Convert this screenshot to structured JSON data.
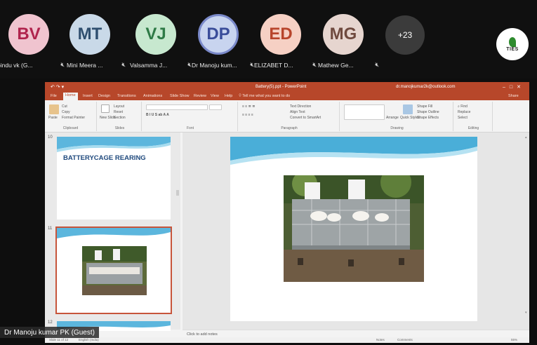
{
  "participants": [
    {
      "initials": "BV",
      "name": "pindu vk (G...",
      "bg": "#f0c4cf",
      "fg": "#b0244d"
    },
    {
      "initials": "MT",
      "name": "Mini Meera ...",
      "bg": "#c9d9e8",
      "fg": "#2f4f6f"
    },
    {
      "initials": "VJ",
      "name": "Valsamma J...",
      "bg": "#c7e8cf",
      "fg": "#2e7a46"
    },
    {
      "initials": "DP",
      "name": "Dr Manoju kum...",
      "bg": "#c8d4ef",
      "fg": "#3a4d9a"
    },
    {
      "initials": "ED",
      "name": "ELIZABET D...",
      "bg": "#f6d0c4",
      "fg": "#b8452c"
    },
    {
      "initials": "MG",
      "name": "Mathew Ge...",
      "bg": "#e6d5cf",
      "fg": "#6f4a3f"
    }
  ],
  "more_count": "+23",
  "logo_text": "TIES",
  "app": {
    "doc_title": "Battery(5).ppt - PowerPoint",
    "account": "dr.manojkumar2k@outlook.com",
    "tabs": [
      "File",
      "Home",
      "Insert",
      "Design",
      "Transitions",
      "Animations",
      "Slide Show",
      "Review",
      "View",
      "Help"
    ],
    "tell_me": "Tell me what you want to do",
    "share": "Share",
    "groups": [
      "Clipboard",
      "Slides",
      "Font",
      "Paragraph",
      "Drawing",
      "Editing"
    ],
    "ribbon": {
      "paste": "Paste",
      "cut": "Cut",
      "copy": "Copy",
      "format_painter": "Format Painter",
      "new_slide": "New Slide",
      "layout": "Layout",
      "reset": "Reset",
      "section": "Section",
      "text_direction": "Text Direction",
      "align_text": "Align Text",
      "smartart": "Convert to SmartArt",
      "arrange": "Arrange",
      "quick_styles": "Quick Styles",
      "shape_fill": "Shape Fill",
      "shape_outline": "Shape Outline",
      "shape_effects": "Shape Effects",
      "find": "Find",
      "replace": "Replace",
      "select": "Select"
    }
  },
  "slides": [
    {
      "number": "10",
      "title": "BATTERYCAGE REARING"
    },
    {
      "number": "11"
    },
    {
      "number": "12"
    }
  ],
  "notes_placeholder": "Click to add notes",
  "status": {
    "slide_info": "Slide 11 of 12",
    "language": "English (India)",
    "notes": "Notes",
    "comments": "Comments",
    "zoom": "55%"
  },
  "presenter_label": "Dr Manoju kumar PK (Guest)"
}
